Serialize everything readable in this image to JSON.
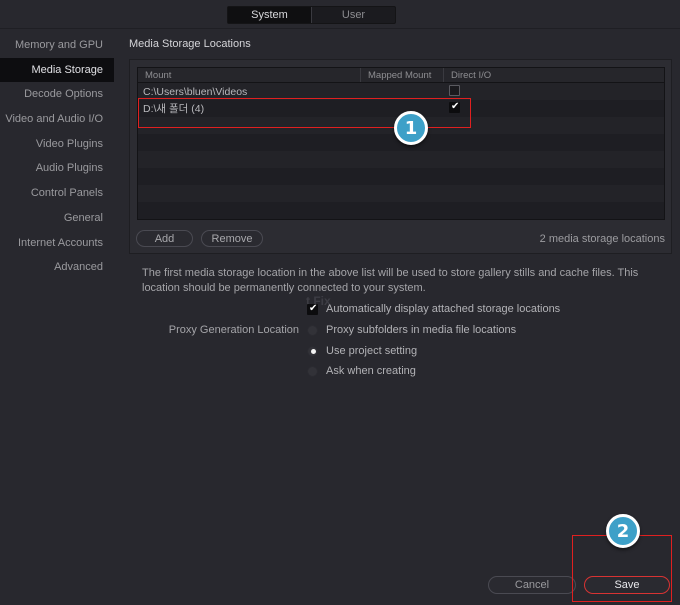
{
  "tabs": {
    "system": "System",
    "user": "User",
    "active": "System"
  },
  "sidebar": {
    "items": [
      {
        "label": "Memory and GPU"
      },
      {
        "label": "Media Storage",
        "active": true
      },
      {
        "label": "Decode Options"
      },
      {
        "label": "Video and Audio I/O"
      },
      {
        "label": "Video Plugins"
      },
      {
        "label": "Audio Plugins"
      },
      {
        "label": "Control Panels"
      },
      {
        "label": "General"
      },
      {
        "label": "Internet Accounts"
      },
      {
        "label": "Advanced"
      }
    ]
  },
  "media_storage": {
    "title": "Media Storage Locations",
    "columns": {
      "mount": "Mount",
      "mapped_mount": "Mapped Mount",
      "direct_io": "Direct I/O"
    },
    "rows": [
      {
        "mount": "C:\\Users\\bluen\\Videos",
        "mapped_mount": "",
        "direct_io": false
      },
      {
        "mount": "D:\\새 폴더 (4)",
        "mapped_mount": "",
        "direct_io": true
      }
    ],
    "add_label": "Add",
    "remove_label": "Remove",
    "count_text": "2 media storage locations"
  },
  "note": "The first media storage location in the above list will be used to store gallery stills and cache files. This location should be permanently connected to your system.",
  "watermark": "t Fix",
  "options": {
    "auto_display_label": "Automatically display attached storage locations",
    "auto_display_checked": true,
    "proxy_label": "Proxy Generation Location",
    "proxy_choices": [
      {
        "label": "Proxy subfolders in media file locations",
        "selected": false
      },
      {
        "label": "Use project setting",
        "selected": true
      },
      {
        "label": "Ask when creating",
        "selected": false
      }
    ]
  },
  "footer": {
    "cancel_label": "Cancel",
    "save_label": "Save"
  },
  "annotations": {
    "callout_1": "1",
    "callout_2": "2",
    "highlight_color": "#e02020",
    "callout_color": "#3da0c8"
  }
}
